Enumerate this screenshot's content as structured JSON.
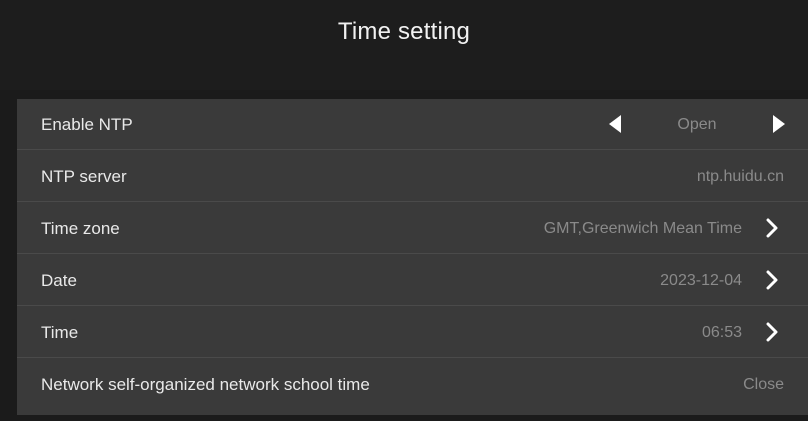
{
  "header": {
    "title": "Time setting"
  },
  "settings": {
    "enable_ntp": {
      "label": "Enable NTP",
      "value": "Open"
    },
    "ntp_server": {
      "label": "NTP server",
      "value": "ntp.huidu.cn"
    },
    "time_zone": {
      "label": "Time zone",
      "value": "GMT,Greenwich Mean Time"
    },
    "date": {
      "label": "Date",
      "value": "2023-12-04"
    },
    "time": {
      "label": "Time",
      "value": "06:53"
    },
    "network_school_time": {
      "label": "Network self-organized network school time",
      "value": "Close"
    }
  },
  "icons": {
    "prev": "triangle-left-icon",
    "next": "triangle-right-icon",
    "chevron": "chevron-right-icon"
  },
  "colors": {
    "background": "#1b1b1b",
    "panel": "#3a3a3a",
    "label_text": "#e9e9e9",
    "value_text": "#8a8a8a",
    "icon": "#ffffff"
  }
}
